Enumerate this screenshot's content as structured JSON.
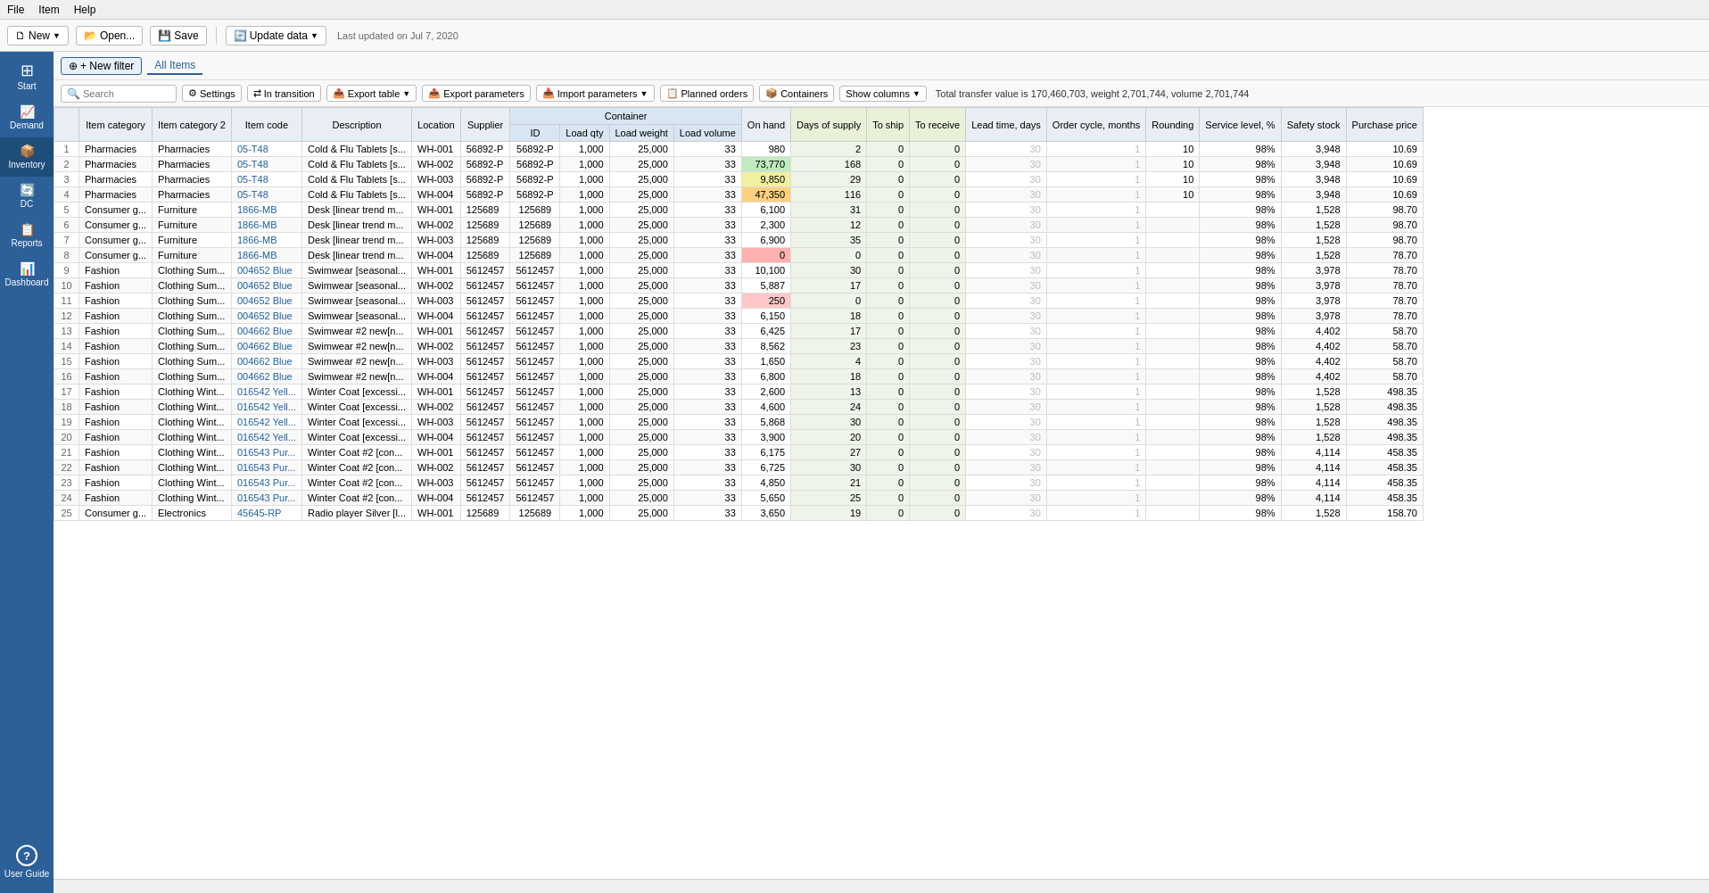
{
  "menu": {
    "items": [
      "File",
      "Item",
      "Help"
    ]
  },
  "toolbar": {
    "new_label": "New",
    "open_label": "Open...",
    "save_label": "Save",
    "update_label": "Update data",
    "last_updated": "Last updated on Jul 7, 2020"
  },
  "filter": {
    "new_filter_label": "+ New filter",
    "all_items_label": "All Items"
  },
  "action_bar": {
    "search_placeholder": "Search",
    "settings_label": "Settings",
    "in_transition_label": "In transition",
    "export_table_label": "Export table",
    "export_params_label": "Export parameters",
    "import_params_label": "Import parameters",
    "planned_orders_label": "Planned orders",
    "containers_label": "Containers",
    "show_columns_label": "Show columns",
    "total_info": "Total transfer value is 170,460,703, weight 2,701,744, volume 2,701,744"
  },
  "sidebar": {
    "items": [
      {
        "id": "start",
        "label": "Start",
        "icon": "⊞"
      },
      {
        "id": "demand",
        "label": "Demand",
        "icon": "📈"
      },
      {
        "id": "inventory",
        "label": "Inventory",
        "icon": "📦"
      },
      {
        "id": "dc",
        "label": "DC",
        "icon": "🔄"
      },
      {
        "id": "reports",
        "label": "Reports",
        "icon": "📋"
      },
      {
        "id": "dashboard",
        "label": "Dashboard",
        "icon": "📊"
      }
    ],
    "user_guide": {
      "label": "User Guide",
      "icon": "?"
    }
  },
  "table": {
    "group_headers": [
      {
        "label": "Container",
        "colspan": 3
      }
    ],
    "columns": [
      "#",
      "Item category",
      "Item category 2",
      "Item code",
      "Description",
      "Location",
      "Supplier",
      "ID",
      "Load qty",
      "Load weight",
      "Load volume",
      "On hand",
      "Days of supply",
      "To ship",
      "To receive",
      "Lead time, days",
      "Order cycle, months",
      "Rounding",
      "Service level, %",
      "Safety stock",
      "Purchase price"
    ],
    "rows": [
      {
        "num": 1,
        "cat1": "Pharmacies",
        "cat2": "Pharmacies",
        "code": "05-T48",
        "desc": "Cold & Flu Tablets [s...",
        "loc": "WH-001",
        "supplier": "56892-P",
        "id": "56892-P",
        "lqty": 1000,
        "lweight": 25000,
        "lvol": 33,
        "onhand": 980,
        "onhand_color": "white",
        "days": 2,
        "toship": 0,
        "toreceive": 0,
        "leadtime": 30,
        "ordercycle": 1,
        "rounding": 10,
        "service": "98%",
        "safety": 3948,
        "price": 10.69
      },
      {
        "num": 2,
        "cat1": "Pharmacies",
        "cat2": "Pharmacies",
        "code": "05-T48",
        "desc": "Cold & Flu Tablets [s...",
        "loc": "WH-002",
        "supplier": "56892-P",
        "id": "56892-P",
        "lqty": 1000,
        "lweight": 25000,
        "lvol": 33,
        "onhand": 73770,
        "onhand_color": "green",
        "days": 168,
        "toship": 0,
        "toreceive": 0,
        "leadtime": 30,
        "ordercycle": 1,
        "rounding": 10,
        "service": "98%",
        "safety": 3948,
        "price": 10.69
      },
      {
        "num": 3,
        "cat1": "Pharmacies",
        "cat2": "Pharmacies",
        "code": "05-T48",
        "desc": "Cold & Flu Tablets [s...",
        "loc": "WH-003",
        "supplier": "56892-P",
        "id": "56892-P",
        "lqty": 1000,
        "lweight": 25000,
        "lvol": 33,
        "onhand": 9850,
        "onhand_color": "yellow",
        "days": 29,
        "toship": 0,
        "toreceive": 0,
        "leadtime": 30,
        "ordercycle": 1,
        "rounding": 10,
        "service": "98%",
        "safety": 3948,
        "price": 10.69
      },
      {
        "num": 4,
        "cat1": "Pharmacies",
        "cat2": "Pharmacies",
        "code": "05-T48",
        "desc": "Cold & Flu Tablets [s...",
        "loc": "WH-004",
        "supplier": "56892-P",
        "id": "56892-P",
        "lqty": 1000,
        "lweight": 25000,
        "lvol": 33,
        "onhand": 47350,
        "onhand_color": "orange",
        "days": 116,
        "toship": 0,
        "toreceive": 0,
        "leadtime": 30,
        "ordercycle": 1,
        "rounding": 10,
        "service": "98%",
        "safety": 3948,
        "price": 10.69
      },
      {
        "num": 5,
        "cat1": "Consumer g...",
        "cat2": "Furniture",
        "code": "1866-MB",
        "desc": "Desk [linear trend m...",
        "loc": "WH-001",
        "supplier": "125689",
        "id": "125689",
        "lqty": 1000,
        "lweight": 25000,
        "lvol": 33,
        "onhand": 6100,
        "onhand_color": "white",
        "days": 31,
        "toship": 0,
        "toreceive": 0,
        "leadtime": 30,
        "ordercycle": 1,
        "rounding": "",
        "service": "98%",
        "safety": 1528,
        "price": 98.7
      },
      {
        "num": 6,
        "cat1": "Consumer g...",
        "cat2": "Furniture",
        "code": "1866-MB",
        "desc": "Desk [linear trend m...",
        "loc": "WH-002",
        "supplier": "125689",
        "id": "125689",
        "lqty": 1000,
        "lweight": 25000,
        "lvol": 33,
        "onhand": 2300,
        "onhand_color": "white",
        "days": 12,
        "toship": 0,
        "toreceive": 0,
        "leadtime": 30,
        "ordercycle": 1,
        "rounding": "",
        "service": "98%",
        "safety": 1528,
        "price": 98.7
      },
      {
        "num": 7,
        "cat1": "Consumer g...",
        "cat2": "Furniture",
        "code": "1866-MB",
        "desc": "Desk [linear trend m...",
        "loc": "WH-003",
        "supplier": "125689",
        "id": "125689",
        "lqty": 1000,
        "lweight": 25000,
        "lvol": 33,
        "onhand": 6900,
        "onhand_color": "white",
        "days": 35,
        "toship": 0,
        "toreceive": 0,
        "leadtime": 30,
        "ordercycle": 1,
        "rounding": "",
        "service": "98%",
        "safety": 1528,
        "price": 98.7
      },
      {
        "num": 8,
        "cat1": "Consumer g...",
        "cat2": "Furniture",
        "code": "1866-MB",
        "desc": "Desk [linear trend m...",
        "loc": "WH-004",
        "supplier": "125689",
        "id": "125689",
        "lqty": 1000,
        "lweight": 25000,
        "lvol": 33,
        "onhand": 0,
        "onhand_color": "red",
        "days": 0,
        "toship": 0,
        "toreceive": 0,
        "leadtime": 30,
        "ordercycle": 1,
        "rounding": "",
        "service": "98%",
        "safety": 1528,
        "price": 78.7
      },
      {
        "num": 9,
        "cat1": "Fashion",
        "cat2": "Clothing Sum...",
        "code": "004652 Blue",
        "desc": "Swimwear [seasonal...",
        "loc": "WH-001",
        "supplier": "5612457",
        "id": "5612457",
        "lqty": 1000,
        "lweight": 25000,
        "lvol": 33,
        "onhand": 10100,
        "onhand_color": "white",
        "days": 30,
        "toship": 0,
        "toreceive": 0,
        "leadtime": 30,
        "ordercycle": 1,
        "rounding": "",
        "service": "98%",
        "safety": 3978,
        "price": 78.7
      },
      {
        "num": 10,
        "cat1": "Fashion",
        "cat2": "Clothing Sum...",
        "code": "004652 Blue",
        "desc": "Swimwear [seasonal...",
        "loc": "WH-002",
        "supplier": "5612457",
        "id": "5612457",
        "lqty": 1000,
        "lweight": 25000,
        "lvol": 33,
        "onhand": 5887,
        "onhand_color": "white",
        "days": 17,
        "toship": 0,
        "toreceive": 0,
        "leadtime": 30,
        "ordercycle": 1,
        "rounding": "",
        "service": "98%",
        "safety": 3978,
        "price": 78.7
      },
      {
        "num": 11,
        "cat1": "Fashion",
        "cat2": "Clothing Sum...",
        "code": "004652 Blue",
        "desc": "Swimwear [seasonal...",
        "loc": "WH-003",
        "supplier": "5612457",
        "id": "5612457",
        "lqty": 1000,
        "lweight": 25000,
        "lvol": 33,
        "onhand": 250,
        "onhand_color": "pink",
        "days": 0,
        "toship": 0,
        "toreceive": 0,
        "leadtime": 30,
        "ordercycle": 1,
        "rounding": "",
        "service": "98%",
        "safety": 3978,
        "price": 78.7
      },
      {
        "num": 12,
        "cat1": "Fashion",
        "cat2": "Clothing Sum...",
        "code": "004652 Blue",
        "desc": "Swimwear [seasonal...",
        "loc": "WH-004",
        "supplier": "5612457",
        "id": "5612457",
        "lqty": 1000,
        "lweight": 25000,
        "lvol": 33,
        "onhand": 6150,
        "onhand_color": "white",
        "days": 18,
        "toship": 0,
        "toreceive": 0,
        "leadtime": 30,
        "ordercycle": 1,
        "rounding": "",
        "service": "98%",
        "safety": 3978,
        "price": 78.7
      },
      {
        "num": 13,
        "cat1": "Fashion",
        "cat2": "Clothing Sum...",
        "code": "004662 Blue",
        "desc": "Swimwear #2 new[n...",
        "loc": "WH-001",
        "supplier": "5612457",
        "id": "5612457",
        "lqty": 1000,
        "lweight": 25000,
        "lvol": 33,
        "onhand": 6425,
        "onhand_color": "white",
        "days": 17,
        "toship": 0,
        "toreceive": 0,
        "leadtime": 30,
        "ordercycle": 1,
        "rounding": "",
        "service": "98%",
        "safety": 4402,
        "price": 58.7
      },
      {
        "num": 14,
        "cat1": "Fashion",
        "cat2": "Clothing Sum...",
        "code": "004662 Blue",
        "desc": "Swimwear #2 new[n...",
        "loc": "WH-002",
        "supplier": "5612457",
        "id": "5612457",
        "lqty": 1000,
        "lweight": 25000,
        "lvol": 33,
        "onhand": 8562,
        "onhand_color": "white",
        "days": 23,
        "toship": 0,
        "toreceive": 0,
        "leadtime": 30,
        "ordercycle": 1,
        "rounding": "",
        "service": "98%",
        "safety": 4402,
        "price": 58.7
      },
      {
        "num": 15,
        "cat1": "Fashion",
        "cat2": "Clothing Sum...",
        "code": "004662 Blue",
        "desc": "Swimwear #2 new[n...",
        "loc": "WH-003",
        "supplier": "5612457",
        "id": "5612457",
        "lqty": 1000,
        "lweight": 25000,
        "lvol": 33,
        "onhand": 1650,
        "onhand_color": "white",
        "days": 4,
        "toship": 0,
        "toreceive": 0,
        "leadtime": 30,
        "ordercycle": 1,
        "rounding": "",
        "service": "98%",
        "safety": 4402,
        "price": 58.7
      },
      {
        "num": 16,
        "cat1": "Fashion",
        "cat2": "Clothing Sum...",
        "code": "004662 Blue",
        "desc": "Swimwear #2 new[n...",
        "loc": "WH-004",
        "supplier": "5612457",
        "id": "5612457",
        "lqty": 1000,
        "lweight": 25000,
        "lvol": 33,
        "onhand": 6800,
        "onhand_color": "white",
        "days": 18,
        "toship": 0,
        "toreceive": 0,
        "leadtime": 30,
        "ordercycle": 1,
        "rounding": "",
        "service": "98%",
        "safety": 4402,
        "price": 58.7
      },
      {
        "num": 17,
        "cat1": "Fashion",
        "cat2": "Clothing Wint...",
        "code": "016542 Yell...",
        "desc": "Winter Coat [excessi...",
        "loc": "WH-001",
        "supplier": "5612457",
        "id": "5612457",
        "lqty": 1000,
        "lweight": 25000,
        "lvol": 33,
        "onhand": 2600,
        "onhand_color": "white",
        "days": 13,
        "toship": 0,
        "toreceive": 0,
        "leadtime": 30,
        "ordercycle": 1,
        "rounding": "",
        "service": "98%",
        "safety": 1528,
        "price": 498.35
      },
      {
        "num": 18,
        "cat1": "Fashion",
        "cat2": "Clothing Wint...",
        "code": "016542 Yell...",
        "desc": "Winter Coat [excessi...",
        "loc": "WH-002",
        "supplier": "5612457",
        "id": "5612457",
        "lqty": 1000,
        "lweight": 25000,
        "lvol": 33,
        "onhand": 4600,
        "onhand_color": "white",
        "days": 24,
        "toship": 0,
        "toreceive": 0,
        "leadtime": 30,
        "ordercycle": 1,
        "rounding": "",
        "service": "98%",
        "safety": 1528,
        "price": 498.35
      },
      {
        "num": 19,
        "cat1": "Fashion",
        "cat2": "Clothing Wint...",
        "code": "016542 Yell...",
        "desc": "Winter Coat [excessi...",
        "loc": "WH-003",
        "supplier": "5612457",
        "id": "5612457",
        "lqty": 1000,
        "lweight": 25000,
        "lvol": 33,
        "onhand": 5868,
        "onhand_color": "white",
        "days": 30,
        "toship": 0,
        "toreceive": 0,
        "leadtime": 30,
        "ordercycle": 1,
        "rounding": "",
        "service": "98%",
        "safety": 1528,
        "price": 498.35
      },
      {
        "num": 20,
        "cat1": "Fashion",
        "cat2": "Clothing Wint...",
        "code": "016542 Yell...",
        "desc": "Winter Coat [excessi...",
        "loc": "WH-004",
        "supplier": "5612457",
        "id": "5612457",
        "lqty": 1000,
        "lweight": 25000,
        "lvol": 33,
        "onhand": 3900,
        "onhand_color": "white",
        "days": 20,
        "toship": 0,
        "toreceive": 0,
        "leadtime": 30,
        "ordercycle": 1,
        "rounding": "",
        "service": "98%",
        "safety": 1528,
        "price": 498.35
      },
      {
        "num": 21,
        "cat1": "Fashion",
        "cat2": "Clothing Wint...",
        "code": "016543 Pur...",
        "desc": "Winter Coat #2 [con...",
        "loc": "WH-001",
        "supplier": "5612457",
        "id": "5612457",
        "lqty": 1000,
        "lweight": 25000,
        "lvol": 33,
        "onhand": 6175,
        "onhand_color": "white",
        "days": 27,
        "toship": 0,
        "toreceive": 0,
        "leadtime": 30,
        "ordercycle": 1,
        "rounding": "",
        "service": "98%",
        "safety": 4114,
        "price": 458.35
      },
      {
        "num": 22,
        "cat1": "Fashion",
        "cat2": "Clothing Wint...",
        "code": "016543 Pur...",
        "desc": "Winter Coat #2 [con...",
        "loc": "WH-002",
        "supplier": "5612457",
        "id": "5612457",
        "lqty": 1000,
        "lweight": 25000,
        "lvol": 33,
        "onhand": 6725,
        "onhand_color": "white",
        "days": 30,
        "toship": 0,
        "toreceive": 0,
        "leadtime": 30,
        "ordercycle": 1,
        "rounding": "",
        "service": "98%",
        "safety": 4114,
        "price": 458.35
      },
      {
        "num": 23,
        "cat1": "Fashion",
        "cat2": "Clothing Wint...",
        "code": "016543 Pur...",
        "desc": "Winter Coat #2 [con...",
        "loc": "WH-003",
        "supplier": "5612457",
        "id": "5612457",
        "lqty": 1000,
        "lweight": 25000,
        "lvol": 33,
        "onhand": 4850,
        "onhand_color": "white",
        "days": 21,
        "toship": 0,
        "toreceive": 0,
        "leadtime": 30,
        "ordercycle": 1,
        "rounding": "",
        "service": "98%",
        "safety": 4114,
        "price": 458.35
      },
      {
        "num": 24,
        "cat1": "Fashion",
        "cat2": "Clothing Wint...",
        "code": "016543 Pur...",
        "desc": "Winter Coat #2 [con...",
        "loc": "WH-004",
        "supplier": "5612457",
        "id": "5612457",
        "lqty": 1000,
        "lweight": 25000,
        "lvol": 33,
        "onhand": 5650,
        "onhand_color": "white",
        "days": 25,
        "toship": 0,
        "toreceive": 0,
        "leadtime": 30,
        "ordercycle": 1,
        "rounding": "",
        "service": "98%",
        "safety": 4114,
        "price": 458.35
      },
      {
        "num": 25,
        "cat1": "Consumer g...",
        "cat2": "Electronics",
        "code": "45645-RP",
        "desc": "Radio player Silver [l...",
        "loc": "WH-001",
        "supplier": "125689",
        "id": "125689",
        "lqty": 1000,
        "lweight": 25000,
        "lvol": 33,
        "onhand": 3650,
        "onhand_color": "white",
        "days": 19,
        "toship": 0,
        "toreceive": 0,
        "leadtime": 30,
        "ordercycle": 1,
        "rounding": "",
        "service": "98%",
        "safety": 1528,
        "price": 158.7
      }
    ]
  }
}
